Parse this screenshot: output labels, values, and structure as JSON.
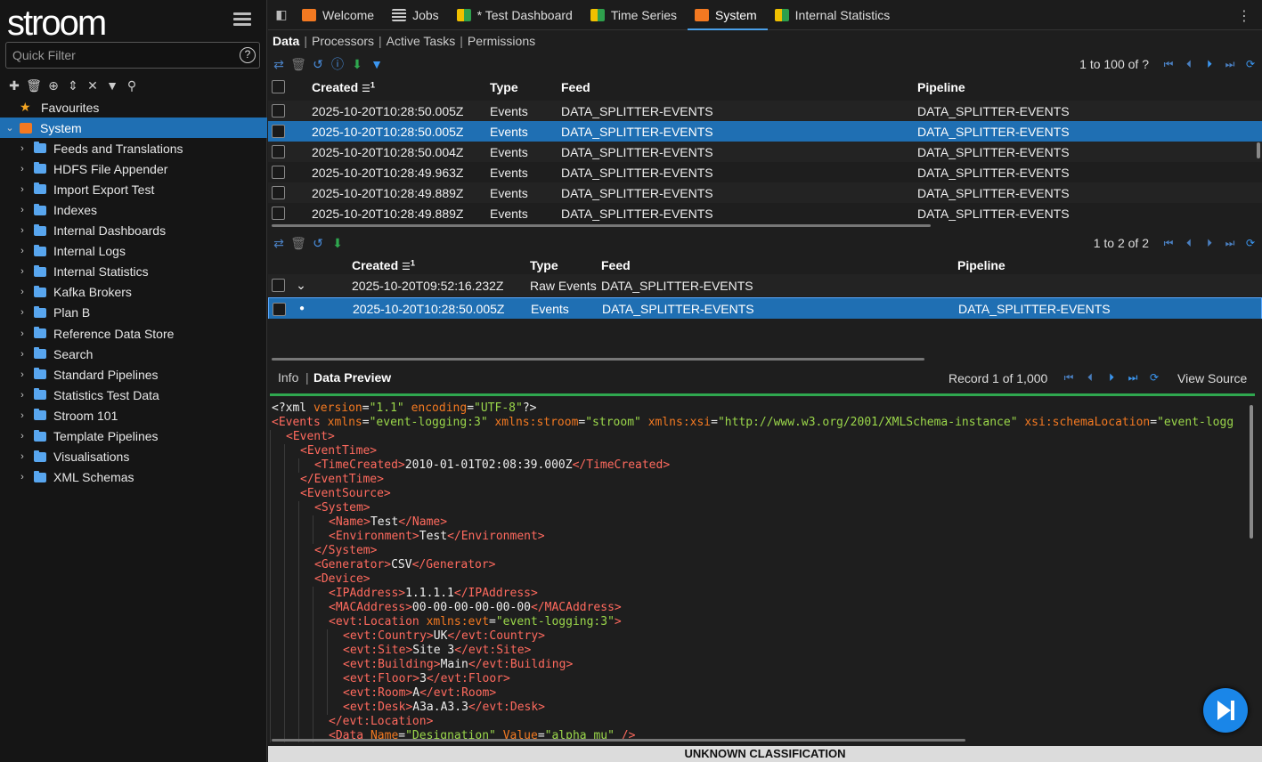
{
  "app": {
    "logo_text": "stroom",
    "quick_filter_placeholder": "Quick Filter",
    "help": "?",
    "classification": "UNKNOWN CLASSIFICATION"
  },
  "tree": {
    "favourites": "Favourites",
    "system": "System",
    "items": [
      "Feeds and Translations",
      "HDFS File Appender",
      "Import Export Test",
      "Indexes",
      "Internal Dashboards",
      "Internal Logs",
      "Internal Statistics",
      "Kafka Brokers",
      "Plan B",
      "Reference Data Store",
      "Search",
      "Standard Pipelines",
      "Statistics Test Data",
      "Stroom 101",
      "Template Pipelines",
      "Visualisations",
      "XML Schemas"
    ]
  },
  "tabs": [
    {
      "label": "Welcome",
      "icon": "stroom-icon"
    },
    {
      "label": "Jobs",
      "icon": "jobs-icon"
    },
    {
      "label": "* Test Dashboard",
      "icon": "dashboard-icon"
    },
    {
      "label": "Time Series",
      "icon": "dashboard-icon"
    },
    {
      "label": "System",
      "icon": "stroom-icon",
      "active": true
    },
    {
      "label": "Internal Statistics",
      "icon": "dashboard-icon"
    }
  ],
  "subnav": {
    "items": [
      "Data",
      "Processors",
      "Active Tasks",
      "Permissions"
    ],
    "sep": "|"
  },
  "upper_grid": {
    "pager": "1 to 100 of ?",
    "headers": {
      "created": "Created",
      "sort": "1",
      "type": "Type",
      "feed": "Feed",
      "pipeline": "Pipeline"
    },
    "rows": [
      {
        "created": "2025-10-20T10:28:50.005Z",
        "type": "Events",
        "feed": "DATA_SPLITTER-EVENTS",
        "pipeline": "DATA_SPLITTER-EVENTS"
      },
      {
        "created": "2025-10-20T10:28:50.005Z",
        "type": "Events",
        "feed": "DATA_SPLITTER-EVENTS",
        "pipeline": "DATA_SPLITTER-EVENTS",
        "selected": true
      },
      {
        "created": "2025-10-20T10:28:50.004Z",
        "type": "Events",
        "feed": "DATA_SPLITTER-EVENTS",
        "pipeline": "DATA_SPLITTER-EVENTS"
      },
      {
        "created": "2025-10-20T10:28:49.963Z",
        "type": "Events",
        "feed": "DATA_SPLITTER-EVENTS",
        "pipeline": "DATA_SPLITTER-EVENTS"
      },
      {
        "created": "2025-10-20T10:28:49.889Z",
        "type": "Events",
        "feed": "DATA_SPLITTER-EVENTS",
        "pipeline": "DATA_SPLITTER-EVENTS"
      },
      {
        "created": "2025-10-20T10:28:49.889Z",
        "type": "Events",
        "feed": "DATA_SPLITTER-EVENTS",
        "pipeline": "DATA_SPLITTER-EVENTS"
      }
    ]
  },
  "lower_grid": {
    "pager": "1 to 2 of 2",
    "headers": {
      "created": "Created",
      "sort": "1",
      "type": "Type",
      "feed": "Feed",
      "pipeline": "Pipeline"
    },
    "rows": [
      {
        "expander": "⌄",
        "created": "2025-10-20T09:52:16.232Z",
        "type": "Raw Events",
        "feed": "DATA_SPLITTER-EVENTS",
        "pipeline": ""
      },
      {
        "expander": "●",
        "created": "2025-10-20T10:28:50.005Z",
        "type": "Events",
        "feed": "DATA_SPLITTER-EVENTS",
        "pipeline": "DATA_SPLITTER-EVENTS",
        "selected": true
      }
    ]
  },
  "preview": {
    "tabs": [
      "Info",
      "Data Preview"
    ],
    "record": "Record 1 of 1,000",
    "view_source": "View Source"
  },
  "xml_lines": [
    {
      "i": 0,
      "t": [
        [
          "p",
          "<?xml "
        ],
        [
          "a",
          "version"
        ],
        [
          "p",
          "="
        ],
        [
          "v",
          "\"1.1\""
        ],
        [
          "p",
          " "
        ],
        [
          "a",
          "encoding"
        ],
        [
          "p",
          "="
        ],
        [
          "v",
          "\"UTF-8\""
        ],
        [
          "p",
          "?>"
        ]
      ]
    },
    {
      "i": 0,
      "t": [
        [
          "g",
          "<Events "
        ],
        [
          "a",
          "xmlns"
        ],
        [
          "p",
          "="
        ],
        [
          "v",
          "\"event-logging:3\""
        ],
        [
          "p",
          " "
        ],
        [
          "a",
          "xmlns:stroom"
        ],
        [
          "p",
          "="
        ],
        [
          "v",
          "\"stroom\""
        ],
        [
          "p",
          " "
        ],
        [
          "a",
          "xmlns:xsi"
        ],
        [
          "p",
          "="
        ],
        [
          "v",
          "\"http://www.w3.org/2001/XMLSchema-instance\""
        ],
        [
          "p",
          " "
        ],
        [
          "a",
          "xsi:schemaLocation"
        ],
        [
          "p",
          "="
        ],
        [
          "v",
          "\"event-logg"
        ]
      ]
    },
    {
      "i": 1,
      "t": [
        [
          "g",
          "<Event>"
        ]
      ]
    },
    {
      "i": 2,
      "t": [
        [
          "g",
          "<EventTime>"
        ]
      ]
    },
    {
      "i": 3,
      "t": [
        [
          "g",
          "<TimeCreated>"
        ],
        [
          "p",
          "2010-01-01T02:08:39.000Z"
        ],
        [
          "g",
          "</TimeCreated>"
        ]
      ]
    },
    {
      "i": 2,
      "t": [
        [
          "g",
          "</EventTime>"
        ]
      ]
    },
    {
      "i": 2,
      "t": [
        [
          "g",
          "<EventSource>"
        ]
      ]
    },
    {
      "i": 3,
      "t": [
        [
          "g",
          "<System>"
        ]
      ]
    },
    {
      "i": 4,
      "t": [
        [
          "g",
          "<Name>"
        ],
        [
          "p",
          "Test"
        ],
        [
          "g",
          "</Name>"
        ]
      ]
    },
    {
      "i": 4,
      "t": [
        [
          "g",
          "<Environment>"
        ],
        [
          "p",
          "Test"
        ],
        [
          "g",
          "</Environment>"
        ]
      ]
    },
    {
      "i": 3,
      "t": [
        [
          "g",
          "</System>"
        ]
      ]
    },
    {
      "i": 3,
      "t": [
        [
          "g",
          "<Generator>"
        ],
        [
          "p",
          "CSV"
        ],
        [
          "g",
          "</Generator>"
        ]
      ]
    },
    {
      "i": 3,
      "t": [
        [
          "g",
          "<Device>"
        ]
      ]
    },
    {
      "i": 4,
      "t": [
        [
          "g",
          "<IPAddress>"
        ],
        [
          "p",
          "1.1.1.1"
        ],
        [
          "g",
          "</IPAddress>"
        ]
      ]
    },
    {
      "i": 4,
      "t": [
        [
          "g",
          "<MACAddress>"
        ],
        [
          "p",
          "00-00-00-00-00-00"
        ],
        [
          "g",
          "</MACAddress>"
        ]
      ]
    },
    {
      "i": 4,
      "t": [
        [
          "g",
          "<evt:Location "
        ],
        [
          "a",
          "xmlns:evt"
        ],
        [
          "p",
          "="
        ],
        [
          "v",
          "\"event-logging:3\""
        ],
        [
          "g",
          ">"
        ]
      ]
    },
    {
      "i": 5,
      "t": [
        [
          "g",
          "<evt:Country>"
        ],
        [
          "p",
          "UK"
        ],
        [
          "g",
          "</evt:Country>"
        ]
      ]
    },
    {
      "i": 5,
      "t": [
        [
          "g",
          "<evt:Site>"
        ],
        [
          "p",
          "Site 3"
        ],
        [
          "g",
          "</evt:Site>"
        ]
      ]
    },
    {
      "i": 5,
      "t": [
        [
          "g",
          "<evt:Building>"
        ],
        [
          "p",
          "Main"
        ],
        [
          "g",
          "</evt:Building>"
        ]
      ]
    },
    {
      "i": 5,
      "t": [
        [
          "g",
          "<evt:Floor>"
        ],
        [
          "p",
          "3"
        ],
        [
          "g",
          "</evt:Floor>"
        ]
      ]
    },
    {
      "i": 5,
      "t": [
        [
          "g",
          "<evt:Room>"
        ],
        [
          "p",
          "A"
        ],
        [
          "g",
          "</evt:Room>"
        ]
      ]
    },
    {
      "i": 5,
      "t": [
        [
          "g",
          "<evt:Desk>"
        ],
        [
          "p",
          "A3a.A3.3"
        ],
        [
          "g",
          "</evt:Desk>"
        ]
      ]
    },
    {
      "i": 4,
      "t": [
        [
          "g",
          "</evt:Location>"
        ]
      ]
    },
    {
      "i": 4,
      "t": [
        [
          "g",
          "<Data "
        ],
        [
          "a",
          "Name"
        ],
        [
          "p",
          "="
        ],
        [
          "v",
          "\"Designation\""
        ],
        [
          "p",
          " "
        ],
        [
          "a",
          "Value"
        ],
        [
          "p",
          "="
        ],
        [
          "v",
          "\"alpha mu\""
        ],
        [
          "p",
          " "
        ],
        [
          "g",
          "/>"
        ]
      ]
    }
  ],
  "colors": {
    "accent": "#1f6fb3",
    "selection": "#1f6fb3",
    "progress": "#2fa84f",
    "tag": "#ff6a5e",
    "attr_name": "#f37921",
    "attr_value": "#9ad64a"
  }
}
